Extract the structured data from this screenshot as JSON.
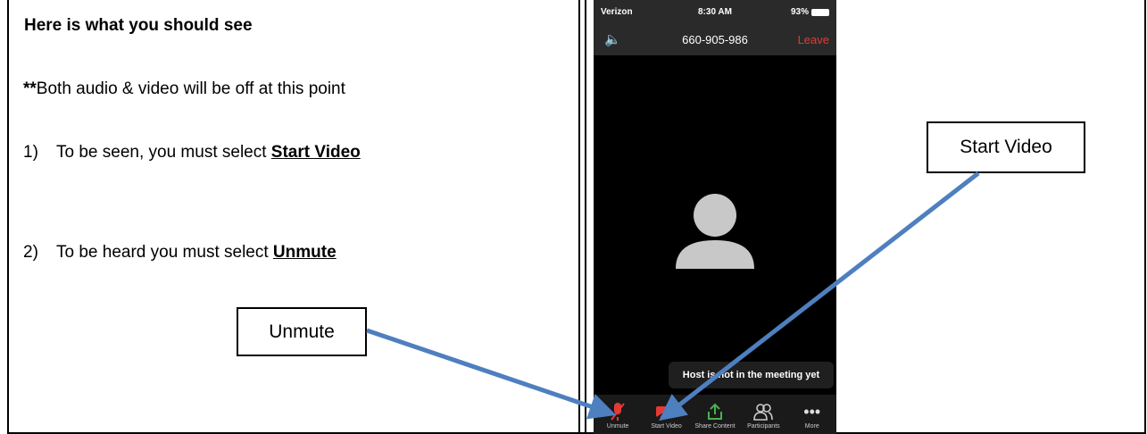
{
  "left_panel": {
    "heading": "Here is what you should see",
    "note_prefix": "**",
    "note_text": "Both audio & video will be off at this point",
    "step1": {
      "number": "1)",
      "text": "To be seen, you must select ",
      "link": "Start Video"
    },
    "step2": {
      "number": "2)",
      "text": "To be heard you must select ",
      "link": "Unmute"
    }
  },
  "callouts": {
    "unmute": "Unmute",
    "start_video": "Start Video"
  },
  "phone": {
    "status": {
      "carrier": "Verizon",
      "time": "8:30 AM",
      "battery": "93%"
    },
    "meeting_id": "660-905-986",
    "leave_label": "Leave",
    "host_banner": "Host is not in the meeting yet",
    "toolbar": [
      {
        "label": "Unmute",
        "icon": "mic-muted-icon"
      },
      {
        "label": "Start Video",
        "icon": "video-off-icon"
      },
      {
        "label": "Share Content",
        "icon": "share-icon"
      },
      {
        "label": "Participants",
        "icon": "participants-icon"
      },
      {
        "label": "More",
        "icon": "more-icon"
      }
    ]
  },
  "colors": {
    "arrow": "#4e7fbf",
    "leave": "#e53935",
    "video_off": "#e53935",
    "share": "#4caf50"
  }
}
